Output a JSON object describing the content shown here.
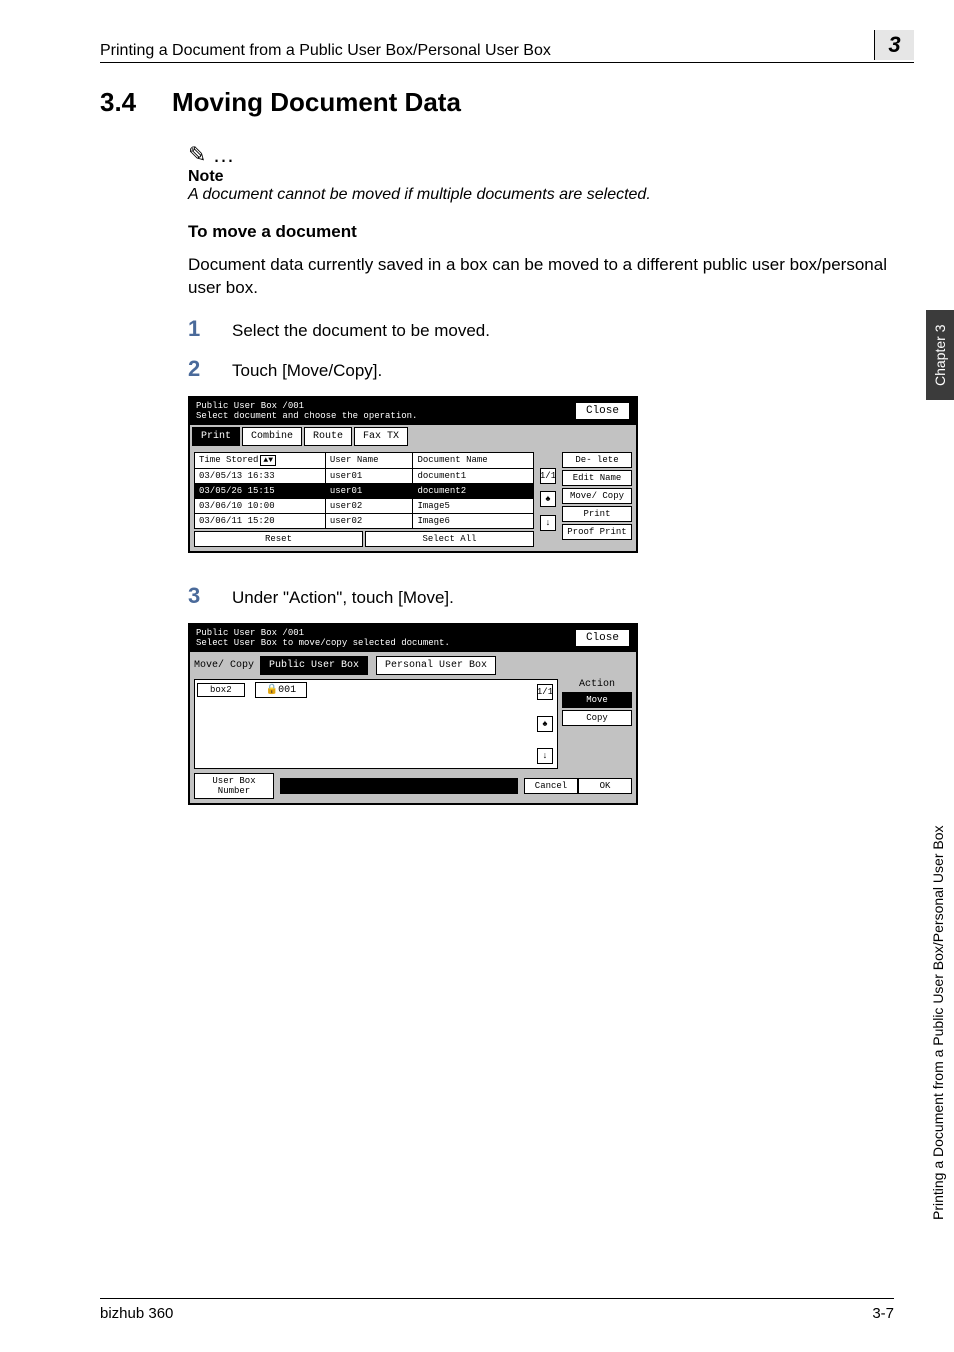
{
  "header": {
    "title": "Printing a Document from a Public User Box/Personal User Box",
    "chapter_number": "3"
  },
  "side": {
    "tab": "Chapter 3",
    "label": "Printing a Document from a Public User Box/Personal User Box"
  },
  "section": {
    "number": "3.4",
    "title": "Moving Document Data"
  },
  "note": {
    "icon": "✎ …",
    "label": "Note",
    "text": "A document cannot be moved if multiple documents are selected."
  },
  "subhead": "To move a document",
  "intro": "Document data currently saved in a box can be moved to a different public user box/personal user box.",
  "steps": [
    {
      "num": "1",
      "text": "Select the document to be moved."
    },
    {
      "num": "2",
      "text": "Touch [Move/Copy]."
    },
    {
      "num": "3",
      "text": "Under \"Action\", touch [Move]."
    }
  ],
  "panel1": {
    "title_line1": "Public",
    "title_line2": "User Box   /001",
    "title_combined": "Public\nUser Box  /001",
    "subtitle": "Select document and choose the operation.",
    "close": "Close",
    "tabs": [
      "Print",
      "Combine",
      "Route",
      "Fax TX"
    ],
    "columns": {
      "c1": "Time Stored",
      "c2": "User Name",
      "c3": "Document Name"
    },
    "page_indicator": "1/1",
    "rows": [
      {
        "time": "03/05/13 16:33",
        "user": "user01",
        "doc": "document1"
      },
      {
        "time": "03/05/26 15:15",
        "user": "user01",
        "doc": "document2"
      },
      {
        "time": "03/06/10 10:00",
        "user": "user02",
        "doc": "Image5"
      },
      {
        "time": "03/06/11 15:20",
        "user": "user02",
        "doc": "Image6"
      }
    ],
    "bottom_buttons": [
      "Reset",
      "Select All"
    ],
    "right_buttons": [
      "De- lete",
      "Edit Name",
      "Move/ Copy",
      "Print",
      "Proof Print"
    ]
  },
  "panel2": {
    "title_combined": "Public\nUser Box   /001",
    "subtitle": "Select User Box to move/copy selected document.",
    "close": "Close",
    "mode": "Move/ Copy",
    "type_tabs": [
      "Public User Box",
      "Personal User Box"
    ],
    "items": [
      "box2",
      "001"
    ],
    "page_indicator": "1/1",
    "action_label": "Action",
    "action_buttons": [
      "Move",
      "Copy"
    ],
    "user_box_label": "User Box Number",
    "cancel": "Cancel",
    "ok": "OK"
  },
  "footer": {
    "left": "bizhub 360",
    "right": "3-7"
  }
}
